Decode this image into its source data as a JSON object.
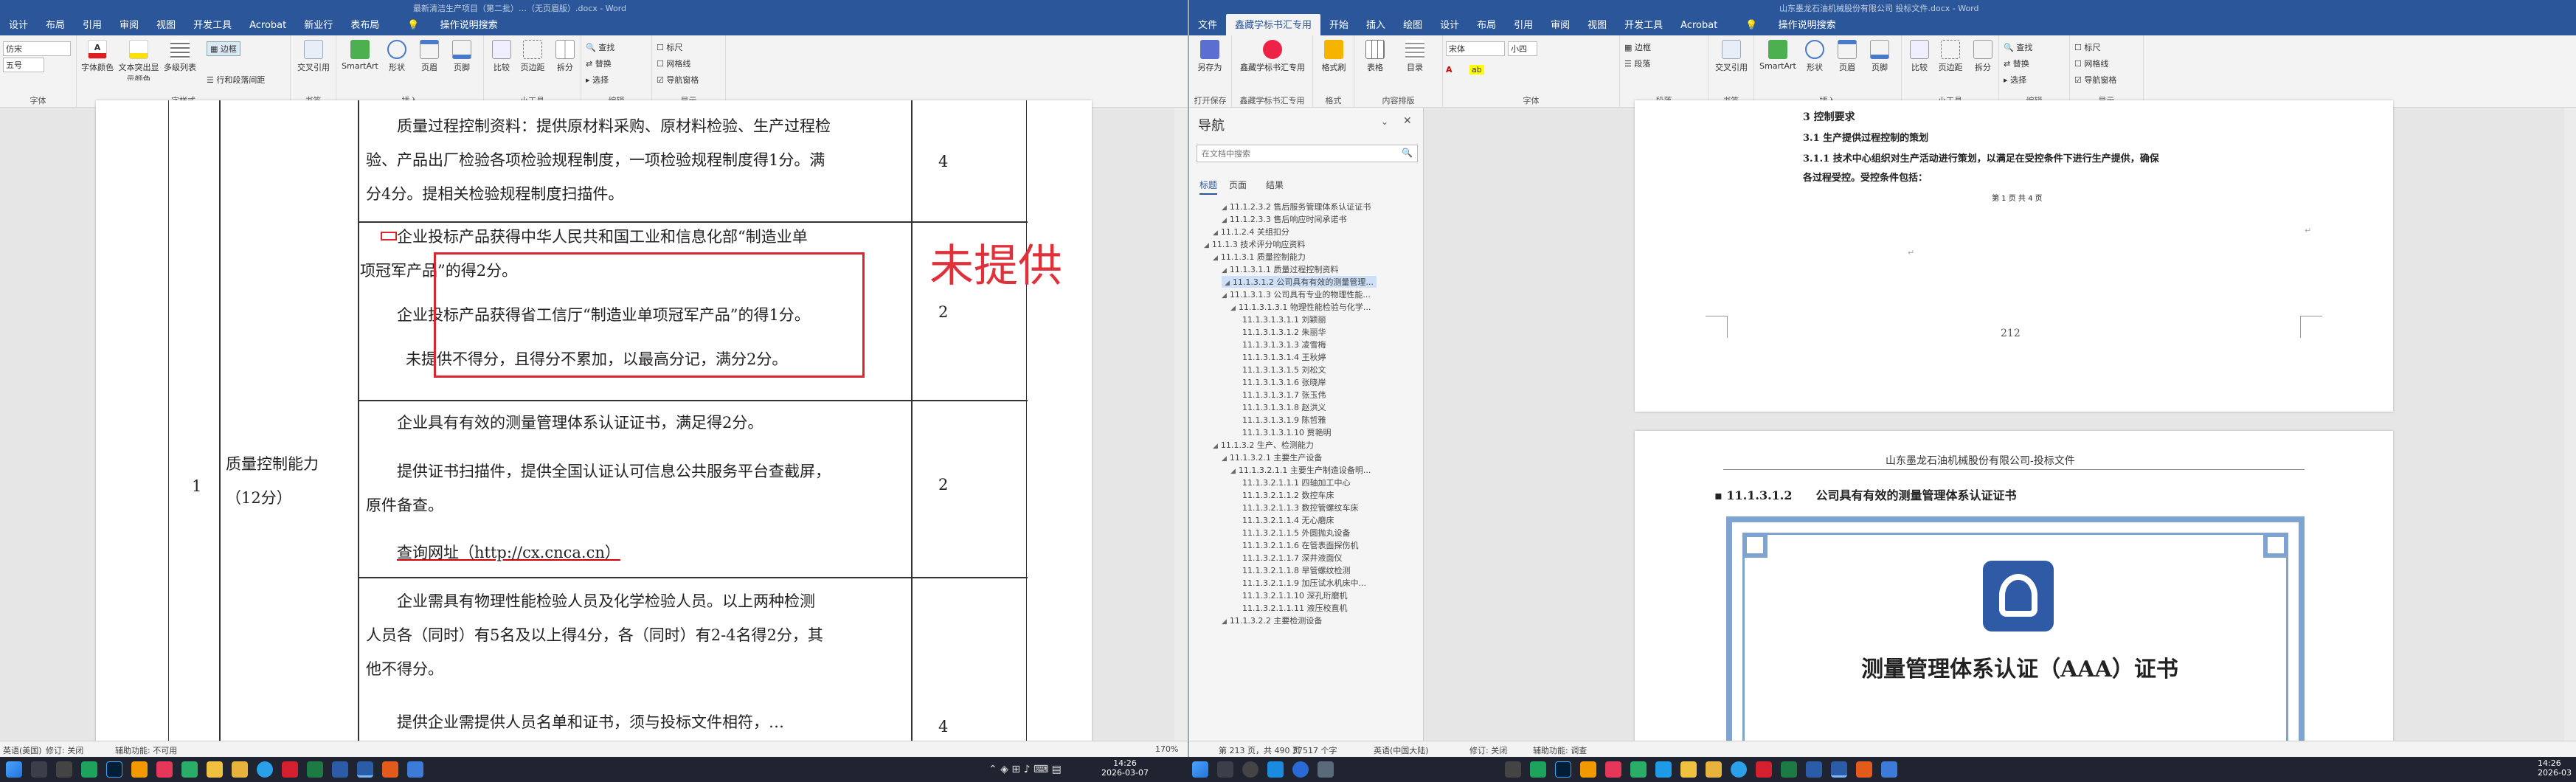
{
  "left_window": {
    "title": "最新清洁生产项目（第二批）…（无页眉版）.docx - Word",
    "menu": [
      "设计",
      "布局",
      "引用",
      "审阅",
      "视图",
      "开发工具",
      "Acrobat",
      "新业行",
      "表布局"
    ],
    "tell_me": "操作说明搜索",
    "ribbon": {
      "font_name": "仿宋",
      "font_size": "五号",
      "groups": [
        "字体",
        "字样式",
        "书签",
        "插入",
        "小工具",
        "编辑",
        "显示"
      ],
      "buttons": [
        "字体颜色",
        "文本突出显示颜色",
        "多级列表",
        "边框",
        "行和段落间距",
        "交叉引用",
        "SmartArt",
        "形状",
        "页眉",
        "页脚",
        "比较",
        "页边距",
        "拆分",
        "查找",
        "替换",
        "选择",
        "标尺",
        "网格线",
        "导航窗格"
      ]
    },
    "table": {
      "row_no": "1",
      "category": "质量控制能力（12分）",
      "cells": [
        {
          "lines": [
            "质量过程控制资料：提供原材料采购、原材料检验、生产过程检",
            "验、产品出厂检验各项检验规程制度，一项检验规程制度得1分。满",
            "分4分。提相关检验规程制度扫描件。"
          ],
          "score": "4"
        },
        {
          "lines": [
            "企业投标产品获得中华人民共和国工业和信息化部“制造业单",
            "项冠军产品”的得2分。",
            "企业投标产品获得省工信厅“制造业单项冠军产品”的得1分。",
            "未提供不得分，且得分不累加，以最高分记，满分2分。"
          ],
          "score": "2"
        },
        {
          "lines": [
            "企业具有有效的测量管理体系认证证书，满足得2分。",
            "提供证书扫描件，提供全国认证认可信息公共服务平台查截屏，",
            "原件备查。",
            "查询网址（http://cx.cnca.cn）"
          ],
          "score": "2"
        },
        {
          "lines": [
            "企业需具有物理性能检验人员及化学检验人员。以上两种检测",
            "人员各（同时）有5名及以上得4分，各（同时）有2-4名得2分，其",
            "他不得分。",
            "提供企业需提供人员名单和证书，须与投标文件相符，…"
          ],
          "score": "4"
        }
      ],
      "annotation": "未提供"
    },
    "status": {
      "items": [
        "英语(美国)",
        "修订: 关闭",
        "辅助功能: 不可用"
      ]
    }
  },
  "right_window": {
    "title": "山东墨龙石油机械股份有限公司 投标文件.docx - Word",
    "menu": [
      "文件",
      "鑫藏学标书汇专用",
      "开始",
      "插入",
      "绘图",
      "设计",
      "布局",
      "引用",
      "审阅",
      "视图",
      "开发工具",
      "Acrobat"
    ],
    "tell_me": "操作说明搜索",
    "ribbon": {
      "font_name": "宋体",
      "font_size": "小四",
      "groups": [
        "打开保存",
        "鑫藏学标书汇专用",
        "格式",
        "内容排版",
        "字体",
        "段落",
        "书签",
        "插入",
        "小工具",
        "编辑",
        "显示"
      ],
      "buttons": [
        "另存为",
        "鑫藏学标书汇专用",
        "格式刷",
        "表格",
        "目录",
        "小四",
        "交叉引用",
        "SmartArt",
        "形状",
        "页眉",
        "页脚",
        "比较",
        "页边距",
        "拆分",
        "查找",
        "替换",
        "选择",
        "标尺",
        "网格线",
        "导航窗格"
      ]
    },
    "nav": {
      "title": "导航",
      "search_placeholder": "在文档中搜索",
      "tabs": [
        "标题",
        "页面",
        "结果"
      ],
      "items": [
        {
          "text": "11.1.2.3.2 售后服务管理体系认证证书",
          "level": 4
        },
        {
          "text": "11.1.2.3.3 售后响应时间承诺书",
          "level": 4
        },
        {
          "text": "11.1.2.4 关组扣分",
          "level": 3
        },
        {
          "text": "11.1.3 技术评分响应资料",
          "level": 2
        },
        {
          "text": "11.1.3.1 质量控制能力",
          "level": 3
        },
        {
          "text": "11.1.3.1.1 质量过程控制资料",
          "level": 4
        },
        {
          "text": "11.1.3.1.2 公司具有有效的测量管理...",
          "level": 4,
          "selected": true
        },
        {
          "text": "11.1.3.1.3 公司具有专业的物理性能...",
          "level": 4
        },
        {
          "text": "11.1.3.1.3.1 物理性能检验与化学...",
          "level": 5
        },
        {
          "text": "11.1.3.1.3.1.1 刘颖丽",
          "level": 6
        },
        {
          "text": "11.1.3.1.3.1.2 朱丽华",
          "level": 6
        },
        {
          "text": "11.1.3.1.3.1.3 凌雪梅",
          "level": 6
        },
        {
          "text": "11.1.3.1.3.1.4 王秋婷",
          "level": 6
        },
        {
          "text": "11.1.3.1.3.1.5 刘松文",
          "level": 6
        },
        {
          "text": "11.1.3.1.3.1.6 张晓岸",
          "level": 6
        },
        {
          "text": "11.1.3.1.3.1.7 张玉伟",
          "level": 6
        },
        {
          "text": "11.1.3.1.3.1.8 赵洪义",
          "level": 6
        },
        {
          "text": "11.1.3.1.3.1.9 陈哲雅",
          "level": 6
        },
        {
          "text": "11.1.3.1.3.1.10 贾艳明",
          "level": 6
        },
        {
          "text": "11.1.3.2 生产、检测能力",
          "level": 3
        },
        {
          "text": "11.1.3.2.1 主要生产设备",
          "level": 4
        },
        {
          "text": "11.1.3.2.1.1 主要生产制造设备明...",
          "level": 5
        },
        {
          "text": "11.1.3.2.1.1.1 四轴加工中心",
          "level": 6
        },
        {
          "text": "11.1.3.2.1.1.2 数控车床",
          "level": 6
        },
        {
          "text": "11.1.3.2.1.1.3 数控管螺纹车床",
          "level": 6
        },
        {
          "text": "11.1.3.2.1.1.4 无心磨床",
          "level": 6
        },
        {
          "text": "11.1.3.2.1.1.5 外圆抛丸设备",
          "level": 6
        },
        {
          "text": "11.1.3.2.1.1.6 在管表面探伤机",
          "level": 6
        },
        {
          "text": "11.1.3.2.1.1.7 深井液面仪",
          "level": 6
        },
        {
          "text": "11.1.3.2.1.1.8 旱管螺纹检测",
          "level": 6
        },
        {
          "text": "11.1.3.2.1.1.9 加压试水机床中...",
          "level": 6
        },
        {
          "text": "11.1.3.2.1.1.10 深孔珩磨机",
          "level": 6
        },
        {
          "text": "11.1.3.2.1.1.11 液压校直机",
          "level": 6
        },
        {
          "text": "11.1.3.2.2 主要检测设备",
          "level": 4
        }
      ]
    },
    "page_top": {
      "heading": "3 控制要求",
      "sub": "3.1 生产提供过程控制的策划",
      "para1": "3.1.1 技术中心组织对生产活动进行策划，以满足在受控条件下进行生产提供，确保",
      "para2": "各过程受控。受控条件包括：",
      "footer_note": "第 1 页 共 4 页",
      "page_num": "212"
    },
    "page_bottom": {
      "header": "山东墨龙石油机械股份有限公司-投标文件",
      "heading": "11.1.3.1.2　　公司具有有效的测量管理体系认证证书",
      "cert_title": "测量管理体系认证（AAA）证书"
    },
    "status": {
      "items": [
        "第 213 页，共 490 页",
        "37517 个字",
        "英语(中国大陆)",
        "修订: 关闭",
        "辅助功能: 调查"
      ],
      "zoom": "170%"
    }
  },
  "taskbar": {
    "time": "14:26",
    "date": "2026-03-07",
    "right_time": "14:26",
    "right_date": "2026-03"
  }
}
